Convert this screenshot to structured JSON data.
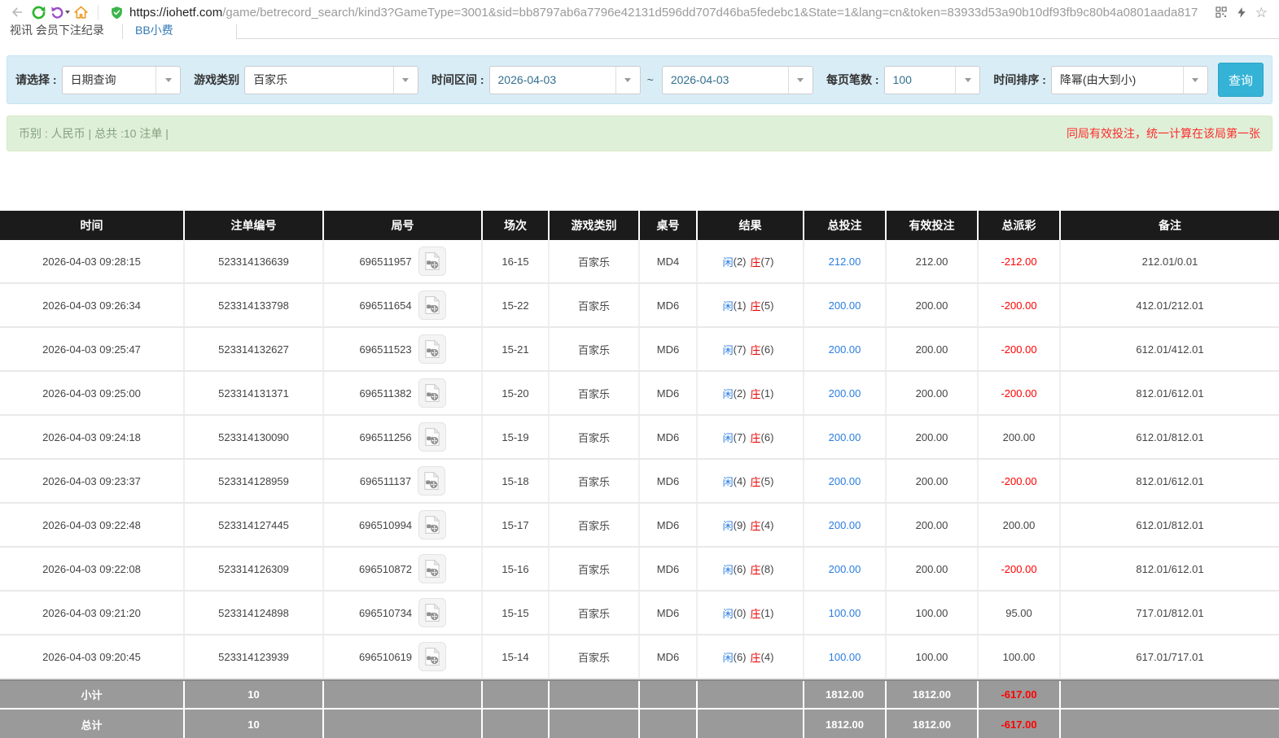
{
  "browser": {
    "url_main": "https://iohetf.com",
    "url_rest": "/game/betrecord_search/kind3?GameType=3001&sid=bb8797ab6a7796e42131d596dd707d46ba5fedebc1&State=1&lang=cn&token=83933d53a90b10df93fb9c80b4a0801aada817"
  },
  "tabs": [
    {
      "label": "视讯 会员下注纪录"
    },
    {
      "label": "BB小费"
    }
  ],
  "filters": {
    "select_label": "请选择 :",
    "select_value": "日期查询",
    "game_type_label": "游戏类别",
    "game_type_value": "百家乐",
    "time_range_label": "时间区间 :",
    "date_from": "2026-04-03",
    "tilde": "~",
    "date_to": "2026-04-03",
    "page_size_label": "每页笔数 :",
    "page_size_value": "100",
    "sort_label": "时间排序 :",
    "sort_value": "降幂(由大到小)",
    "search_button": "查询"
  },
  "info_bar": {
    "left": "币别 : 人民币 | 总共 :10 注单 |",
    "right": "同局有效投注，统一计算在该局第一张"
  },
  "table": {
    "headers": [
      "时间",
      "注单编号",
      "局号",
      "场次",
      "游戏类别",
      "桌号",
      "结果",
      "总投注",
      "有效投注",
      "总派彩",
      "备注"
    ],
    "rows": [
      {
        "time": "2026-04-03 09:28:15",
        "bet_id": "523314136639",
        "round_id": "696511957",
        "session": "16-15",
        "game": "百家乐",
        "table_no": "MD4",
        "player_label": "闲",
        "player_score": "(2)",
        "banker_label": "庄",
        "banker_score": "(7)",
        "total_bet": "212.00",
        "valid_bet": "212.00",
        "payout": "-212.00",
        "remark": "212.01/0.01"
      },
      {
        "time": "2026-04-03 09:26:34",
        "bet_id": "523314133798",
        "round_id": "696511654",
        "session": "15-22",
        "game": "百家乐",
        "table_no": "MD6",
        "player_label": "闲",
        "player_score": "(1)",
        "banker_label": "庄",
        "banker_score": "(5)",
        "total_bet": "200.00",
        "valid_bet": "200.00",
        "payout": "-200.00",
        "remark": "412.01/212.01"
      },
      {
        "time": "2026-04-03 09:25:47",
        "bet_id": "523314132627",
        "round_id": "696511523",
        "session": "15-21",
        "game": "百家乐",
        "table_no": "MD6",
        "player_label": "闲",
        "player_score": "(7)",
        "banker_label": "庄",
        "banker_score": "(6)",
        "total_bet": "200.00",
        "valid_bet": "200.00",
        "payout": "-200.00",
        "remark": "612.01/412.01"
      },
      {
        "time": "2026-04-03 09:25:00",
        "bet_id": "523314131371",
        "round_id": "696511382",
        "session": "15-20",
        "game": "百家乐",
        "table_no": "MD6",
        "player_label": "闲",
        "player_score": "(2)",
        "banker_label": "庄",
        "banker_score": "(1)",
        "total_bet": "200.00",
        "valid_bet": "200.00",
        "payout": "-200.00",
        "remark": "812.01/612.01"
      },
      {
        "time": "2026-04-03 09:24:18",
        "bet_id": "523314130090",
        "round_id": "696511256",
        "session": "15-19",
        "game": "百家乐",
        "table_no": "MD6",
        "player_label": "闲",
        "player_score": "(7)",
        "banker_label": "庄",
        "banker_score": "(6)",
        "total_bet": "200.00",
        "valid_bet": "200.00",
        "payout": "200.00",
        "remark": "612.01/812.01"
      },
      {
        "time": "2026-04-03 09:23:37",
        "bet_id": "523314128959",
        "round_id": "696511137",
        "session": "15-18",
        "game": "百家乐",
        "table_no": "MD6",
        "player_label": "闲",
        "player_score": "(4)",
        "banker_label": "庄",
        "banker_score": "(5)",
        "total_bet": "200.00",
        "valid_bet": "200.00",
        "payout": "-200.00",
        "remark": "812.01/612.01"
      },
      {
        "time": "2026-04-03 09:22:48",
        "bet_id": "523314127445",
        "round_id": "696510994",
        "session": "15-17",
        "game": "百家乐",
        "table_no": "MD6",
        "player_label": "闲",
        "player_score": "(9)",
        "banker_label": "庄",
        "banker_score": "(4)",
        "total_bet": "200.00",
        "valid_bet": "200.00",
        "payout": "200.00",
        "remark": "612.01/812.01"
      },
      {
        "time": "2026-04-03 09:22:08",
        "bet_id": "523314126309",
        "round_id": "696510872",
        "session": "15-16",
        "game": "百家乐",
        "table_no": "MD6",
        "player_label": "闲",
        "player_score": "(6)",
        "banker_label": "庄",
        "banker_score": "(8)",
        "total_bet": "200.00",
        "valid_bet": "200.00",
        "payout": "-200.00",
        "remark": "812.01/612.01"
      },
      {
        "time": "2026-04-03 09:21:20",
        "bet_id": "523314124898",
        "round_id": "696510734",
        "session": "15-15",
        "game": "百家乐",
        "table_no": "MD6",
        "player_label": "闲",
        "player_score": "(0)",
        "banker_label": "庄",
        "banker_score": "(1)",
        "total_bet": "100.00",
        "valid_bet": "100.00",
        "payout": "95.00",
        "remark": "717.01/812.01"
      },
      {
        "time": "2026-04-03 09:20:45",
        "bet_id": "523314123939",
        "round_id": "696510619",
        "session": "15-14",
        "game": "百家乐",
        "table_no": "MD6",
        "player_label": "闲",
        "player_score": "(6)",
        "banker_label": "庄",
        "banker_score": "(4)",
        "total_bet": "100.00",
        "valid_bet": "100.00",
        "payout": "100.00",
        "remark": "617.01/717.01"
      }
    ],
    "subtotal": {
      "label": "小计",
      "count": "10",
      "total_bet": "1812.00",
      "valid_bet": "1812.00",
      "payout": "-617.00"
    },
    "total": {
      "label": "总计",
      "count": "10",
      "total_bet": "1812.00",
      "valid_bet": "1812.00",
      "payout": "-617.00"
    }
  },
  "colors": {
    "accent_blue": "#2a7de0",
    "negative_red": "#f00000",
    "player_blue": "#2a7de0",
    "banker_red": "#e60000",
    "header_bg": "#1b1b1b",
    "footer_bg": "#9a9a9a",
    "search_button": "#35b3d6",
    "filter_bar_bg": "#d9edf7",
    "info_bar_bg": "#dff0d8",
    "info_text_green": "#85a083",
    "warning_red": "#fd2b2b"
  }
}
